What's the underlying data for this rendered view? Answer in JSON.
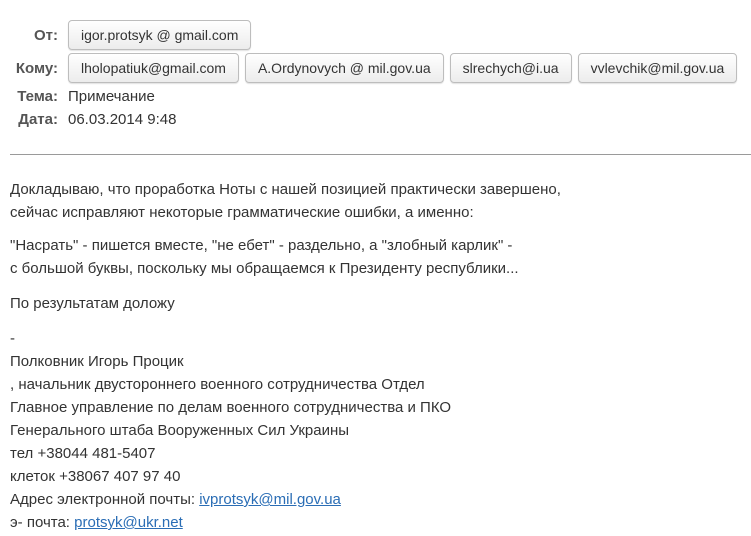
{
  "header": {
    "from_label": "От:",
    "from_chips": [
      "igor.protsyk @ gmail.com"
    ],
    "to_label": "Кому:",
    "to_chips": [
      "lholopatiuk@gmail.com",
      "A.Ordynovych @ mil.gov.ua",
      "slrechych@i.ua",
      "vvlevchik@mil.gov.ua"
    ],
    "subject_label": "Тема:",
    "subject_value": "Примечание",
    "date_label": "Дата:",
    "date_value": "06.03.2014 9:48"
  },
  "body": {
    "p1_line1": "Докладываю, что проработка Ноты с нашей позицией практически завершено,",
    "p1_line2": "сейчас исправляют некоторые грамматические ошибки, а именно:",
    "p2_line1": "\"Насрать\" - пишется вместе, \"не ебет\" - раздельно, а \"злобный карлик\" -",
    "p2_line2": "с большой буквы, поскольку мы обращаемся к Президенту республики...",
    "p3": "По результатам доложу",
    "sig_dash": "-",
    "sig_name": "Полковник Игорь Процик",
    "sig_line2": ", начальник двустороннего военного сотрудничества Отдел",
    "sig_line3": "Главное управление по делам военного сотрудничества и ПКО",
    "sig_line4": "Генерального штаба Вооруженных Сил Украины",
    "sig_phone": "тел +38044 481-5407",
    "sig_cell": "клеток +38067 407 97 40",
    "email_label": "Адрес электронной почты: ",
    "email_link": "ivprotsyk@mil.gov.ua",
    "email2_label": "э- почта: ",
    "email2_link": "protsyk@ukr.net"
  }
}
